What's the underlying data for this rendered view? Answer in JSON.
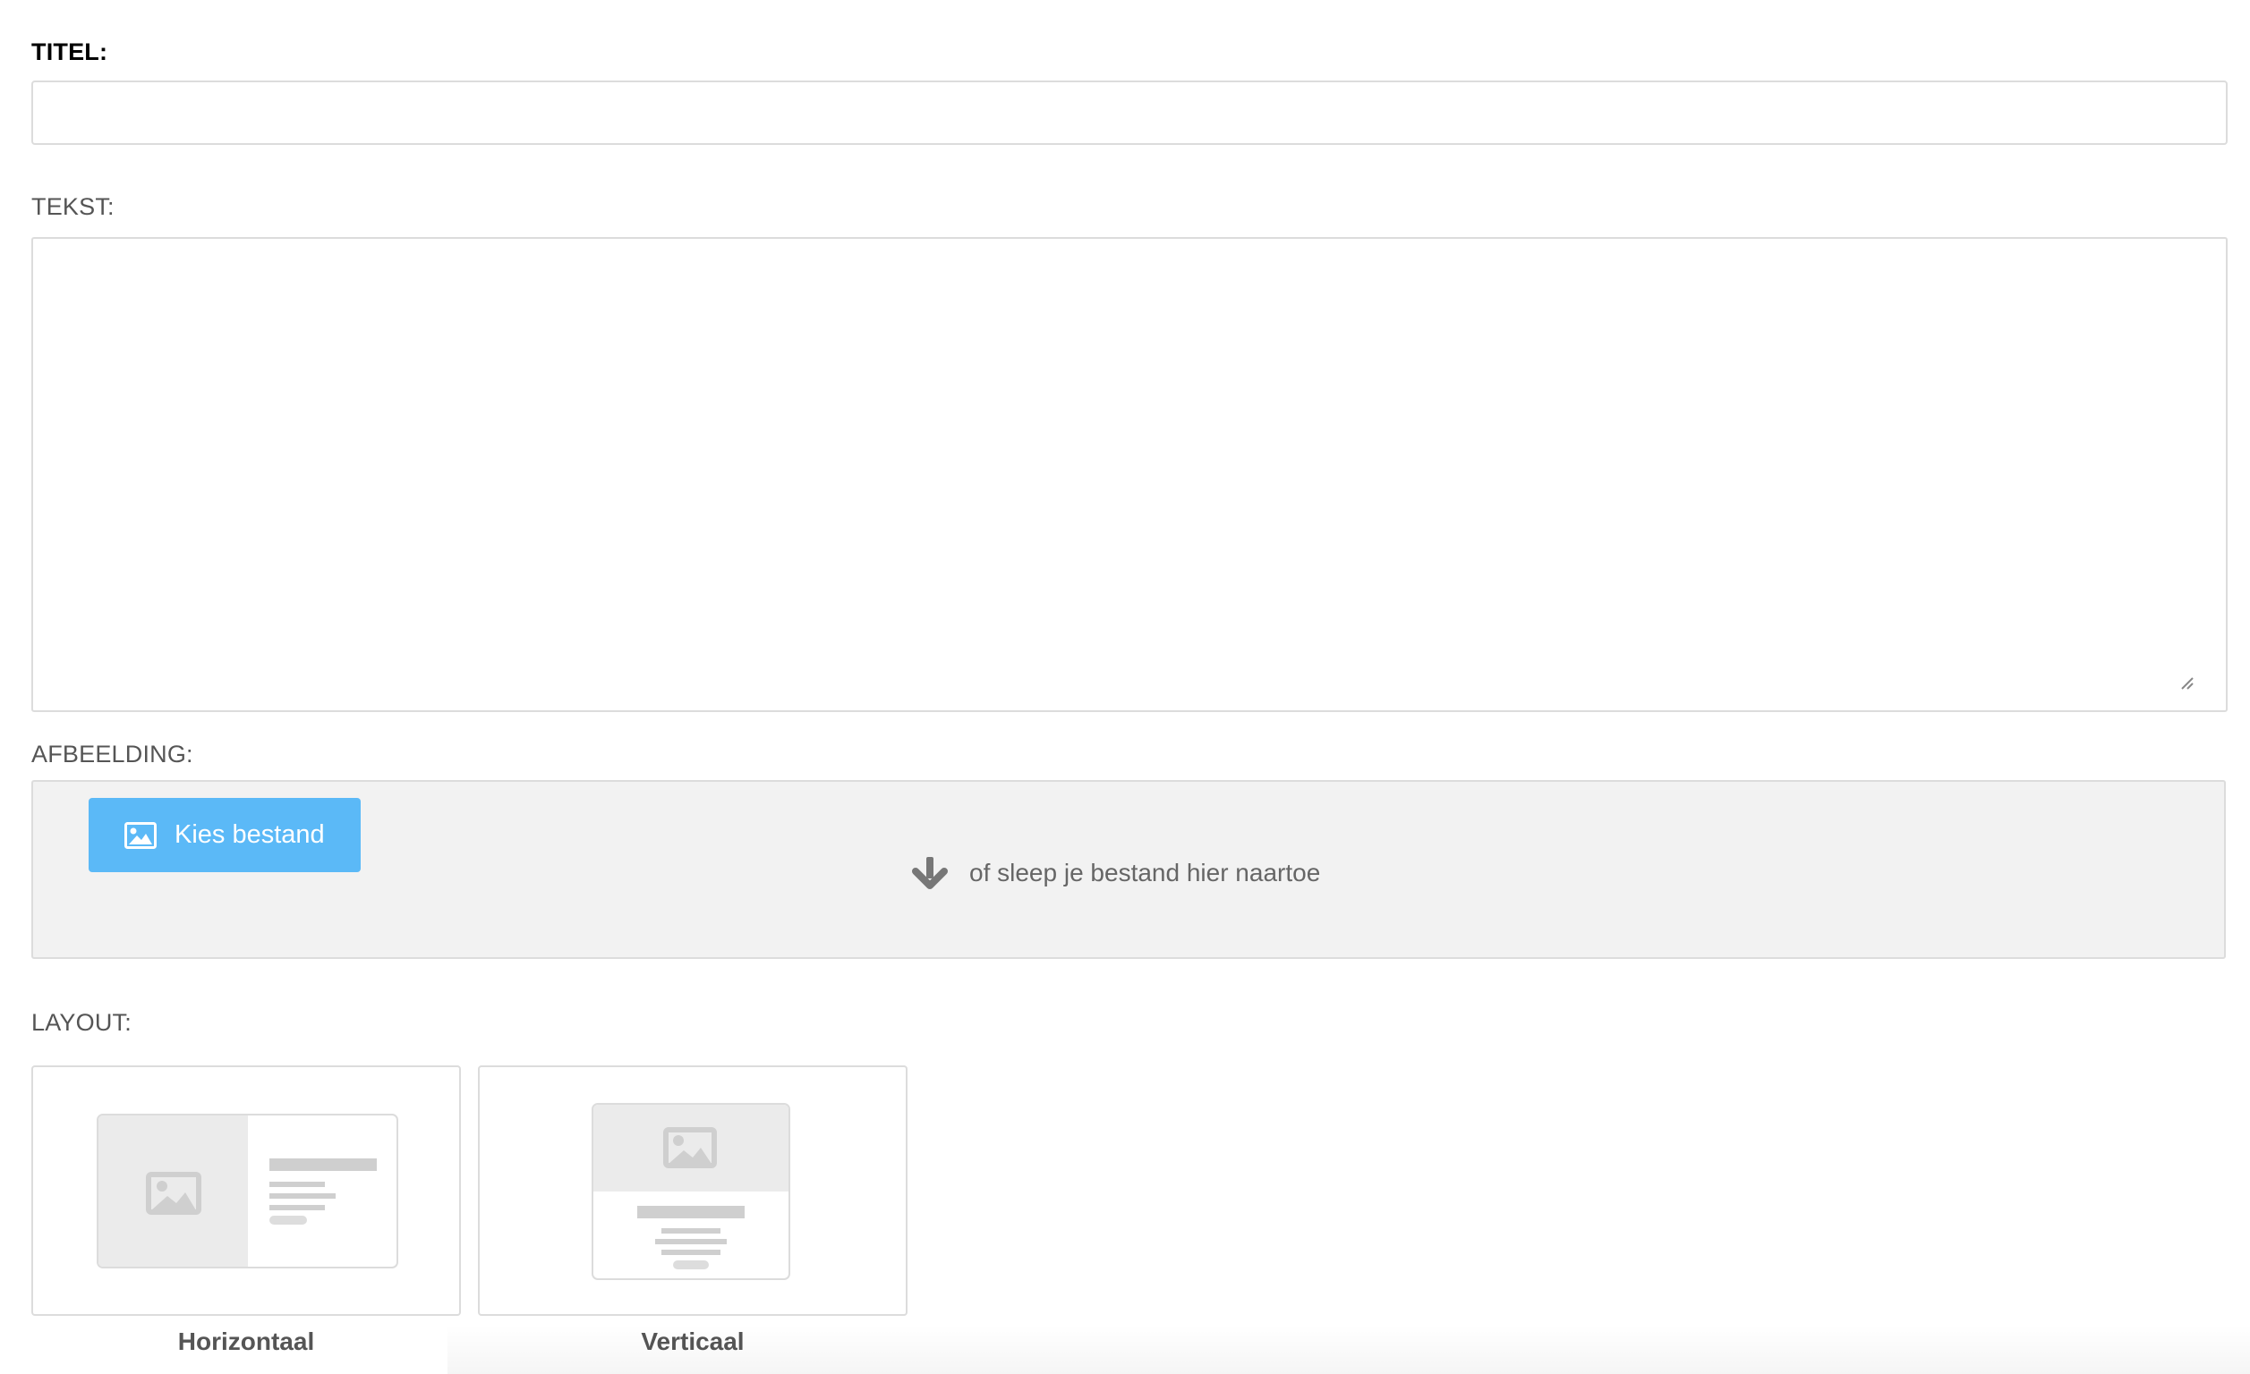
{
  "form": {
    "title": {
      "label": "TITEL:",
      "value": "",
      "placeholder": ""
    },
    "text": {
      "label": "TEKST:",
      "value": "",
      "placeholder": ""
    },
    "image": {
      "label": "AFBEELDING:",
      "choose_button_label": "Kies bestand",
      "drop_hint": "of sleep je bestand hier naartoe"
    },
    "layout": {
      "label": "LAYOUT:",
      "options": [
        {
          "label": "Horizontaal",
          "icon": "layout-horizontal-icon"
        },
        {
          "label": "Verticaal",
          "icon": "layout-vertical-icon"
        }
      ]
    }
  },
  "colors": {
    "primary_button": "#5bb9f7",
    "dropzone_background": "#f2f2f2",
    "border": "#dcdcdc",
    "placeholder_gray": "#d3d3d3"
  }
}
